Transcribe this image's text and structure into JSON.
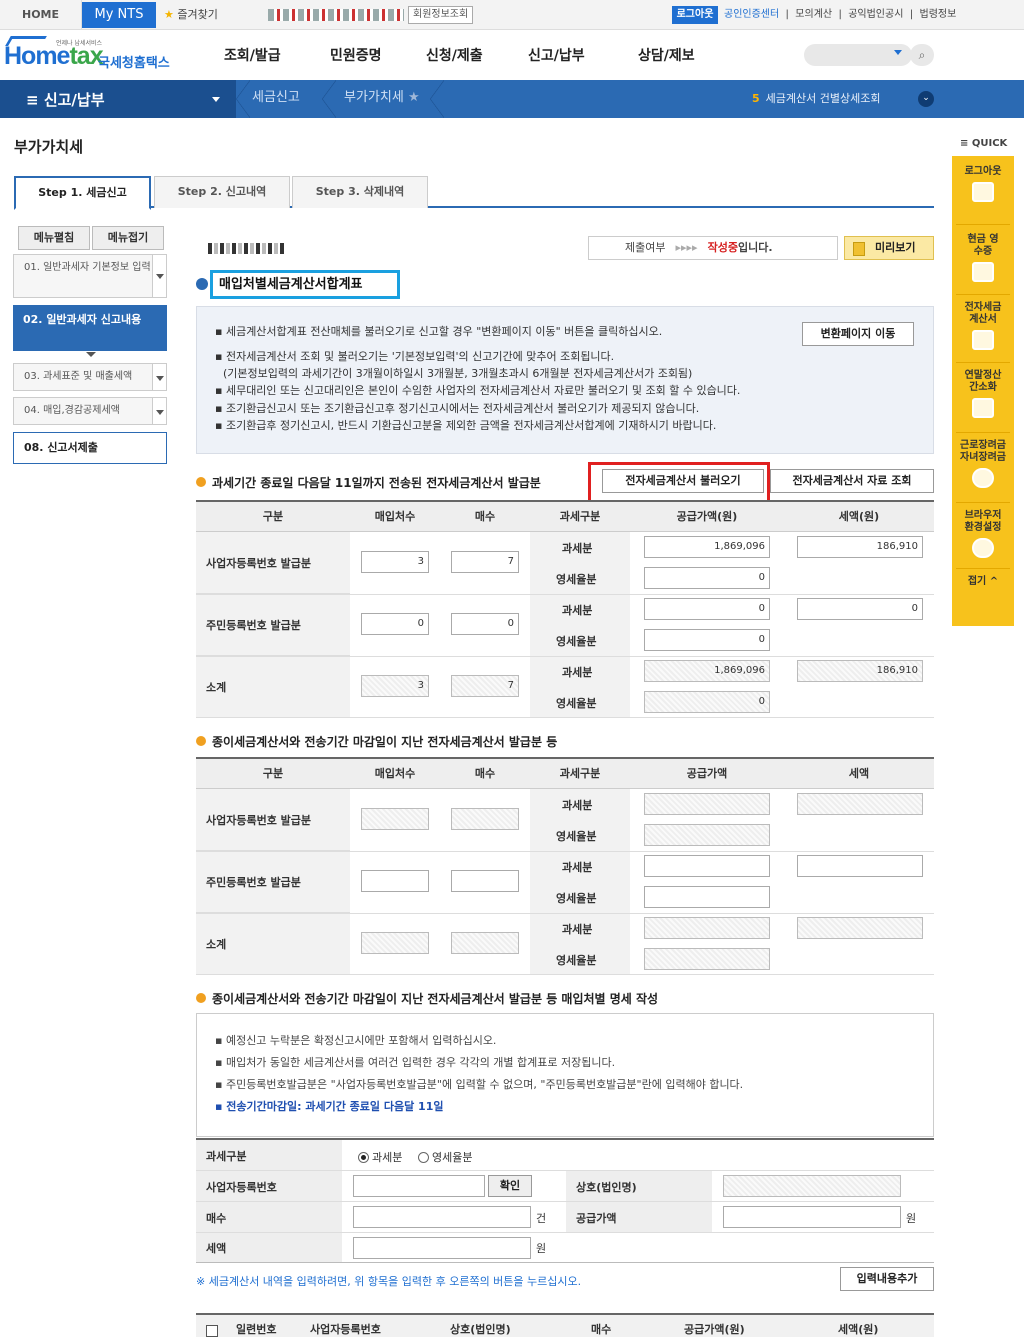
{
  "topbar": {
    "home": "HOME",
    "mynts": "My NTS",
    "favorites": "즐겨찾기",
    "user_info": "회원정보조회",
    "logout": "로그아웃",
    "links": [
      "공인인증센터",
      "모의계산",
      "공익법인공시",
      "법령정보"
    ]
  },
  "header": {
    "logo_main": "Home",
    "logo_accent": "tax",
    "logo_korean": "국세청홈택스",
    "logo_tiny": "언제나 납세서비스",
    "menu": [
      "조회/발급",
      "민원증명",
      "신청/제출",
      "신고/납부",
      "상담/제보"
    ]
  },
  "bluenav": {
    "main": "신고/납부",
    "crumbs": [
      "세금신고",
      "부가가치세"
    ],
    "right_num": "5",
    "right_text": "세금계산서 건별상세조회"
  },
  "page": {
    "title": "부가가치세"
  },
  "steps": [
    "Step 1. 세금신고",
    "Step 2. 신고내역",
    "Step 3. 삭제내역"
  ],
  "sidebar": {
    "expand": "메뉴펼침",
    "collapse": "메뉴접기",
    "items": [
      "01. 일반과세자 기본정보 입력",
      "02. 일반과세자 신고내용",
      "03. 과세표준 및 매출세액",
      "04. 매입,경감공제세액",
      "08. 신고서제출"
    ]
  },
  "status": {
    "label": "제출여부",
    "arrows": "▸▸▸▸",
    "state": "작성중",
    "suffix": "입니다.",
    "preview": "미리보기"
  },
  "section": {
    "title": "매입처별세금계산서합계표"
  },
  "info1": {
    "lines": [
      "▪ 세금계산서합계표 전산매체를 불러오기로 신고할 경우 \"변환페이지 이동\" 버튼을 클릭하십시오.",
      "▪ 전자세금계산서 조회 및 불러오기는 '기본정보입력'의 신고기간에 맞추어 조회됩니다.",
      "(기본정보입력의 과세기간이 3개월이하일시 3개월분, 3개월초과시 6개월분 전자세금계산서가 조회됨)",
      "▪ 세무대리인 또는 신고대리인은 본인이 수임한 사업자의 전자세금계산서 자료만 불러오기 및 조회 할 수 있습니다.",
      "▪ 조기환급신고시 또는 조기환급신고후 정기신고시에서는 전자세금계산서 불러오기가 제공되지 않습니다.",
      "▪ 조기환급후 정기신고시, 반드시 기환급신고분을 제외한 금액을 전자세금계산서합계에 기재하시기 바랍니다."
    ],
    "move_btn": "변환페이지 이동"
  },
  "sub1": {
    "title": "과세기간 종료일 다음달 11일까지 전송된 전자세금계산서 발급분",
    "load_btn": "전자세금계산서 불러오기",
    "query_btn": "전자세금계산서 자료 조회"
  },
  "table1": {
    "headers": [
      "구분",
      "매입처수",
      "매수",
      "과세구분",
      "공급가액(원)",
      "세액(원)"
    ],
    "rows": [
      {
        "label": "사업자등록번호 발급분",
        "count": "3",
        "sheets": "7",
        "taxable": "과세분",
        "zero": "영세율분",
        "supply_tax": "1,869,096",
        "supply_zero": "0",
        "tax": "186,910"
      },
      {
        "label": "주민등록번호 발급분",
        "count": "0",
        "sheets": "0",
        "taxable": "과세분",
        "zero": "영세율분",
        "supply_tax": "0",
        "supply_zero": "0",
        "tax": "0"
      },
      {
        "label": "소계",
        "count": "3",
        "sheets": "7",
        "taxable": "과세분",
        "zero": "영세율분",
        "supply_tax": "1,869,096",
        "supply_zero": "0",
        "tax": "186,910"
      }
    ]
  },
  "sub2": {
    "title": "종이세금계산서와 전송기간 마감일이 지난 전자세금계산서 발급분 등"
  },
  "table2": {
    "headers": [
      "구분",
      "매입처수",
      "매수",
      "과세구분",
      "공급가액",
      "세액"
    ],
    "rows": [
      {
        "label": "사업자등록번호 발급분",
        "taxable": "과세분",
        "zero": "영세율분"
      },
      {
        "label": "주민등록번호 발급분",
        "taxable": "과세분",
        "zero": "영세율분"
      },
      {
        "label": "소계",
        "taxable": "과세분",
        "zero": "영세율분"
      }
    ]
  },
  "sub3": {
    "title": "종이세금계산서와 전송기간 마감일이 지난 전자세금계산서 발급분 등 매입처별 명세 작성"
  },
  "info2": {
    "lines": [
      "▪ 예정신고 누락분은 확정신고시에만 포함해서 입력하십시오.",
      "▪ 매입처가 동일한 세금계산서를 여러건 입력한 경우 각각의 개별 합계표로 저장됩니다.",
      "▪ 주민등록번호발급분은 \"사업자등록번호발급분\"에 입력할 수 없으며, \"주민등록번호발급분\"란에 입력해야 합니다."
    ],
    "highlight": "▪ 전송기간마감일: 과세기간 종료일 다음달 11일"
  },
  "form": {
    "tax_type_label": "과세구분",
    "opt_taxable": "과세분",
    "opt_zero": "영세율분",
    "bizno_label": "사업자등록번호",
    "confirm": "확인",
    "company_label": "상호(법인명)",
    "sheets_label": "매수",
    "sheets_unit": "건",
    "supply_label": "공급가액",
    "supply_unit": "원",
    "tax_label": "세액",
    "tax_unit": "원"
  },
  "note": {
    "text": "※ 세금계산서 내역을 입력하려면, 위 항목을 입력한 후 오른쪽의 버튼을 누르십시오.",
    "add_btn": "입력내용추가"
  },
  "list": {
    "headers": [
      "일련번호",
      "사업자등록번호",
      "상호(법인명)",
      "매수",
      "공급가액(원)",
      "세액(원)"
    ]
  },
  "quick": {
    "label": "QUICK",
    "items": [
      "로그아웃",
      "현금 영수증",
      "전자세금 계산서",
      "연말정산 간소화",
      "근로장려금 자녀장려금",
      "브라우저 환경설정"
    ],
    "fold": "접기"
  }
}
